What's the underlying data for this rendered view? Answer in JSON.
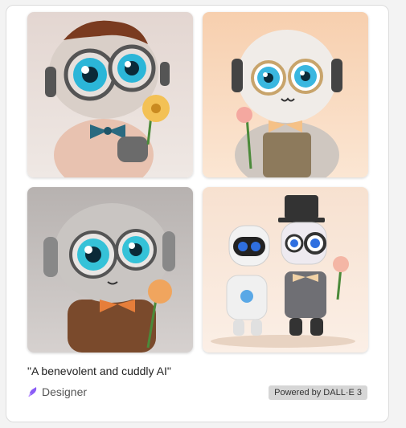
{
  "result": {
    "images": [
      {
        "name": "generated-image-1"
      },
      {
        "name": "generated-image-2"
      },
      {
        "name": "generated-image-3"
      },
      {
        "name": "generated-image-4"
      }
    ],
    "prompt": "\"A benevolent and cuddly AI\"",
    "brand_label": "Designer",
    "brand_icon": "designer-logo-icon",
    "badge": "Powered by DALL·E 3"
  },
  "colors": {
    "card_bg": "#ffffff",
    "card_border": "#dcdcdc",
    "badge_bg": "#d6d6d6",
    "brand_icon": "#8a5cf6"
  }
}
